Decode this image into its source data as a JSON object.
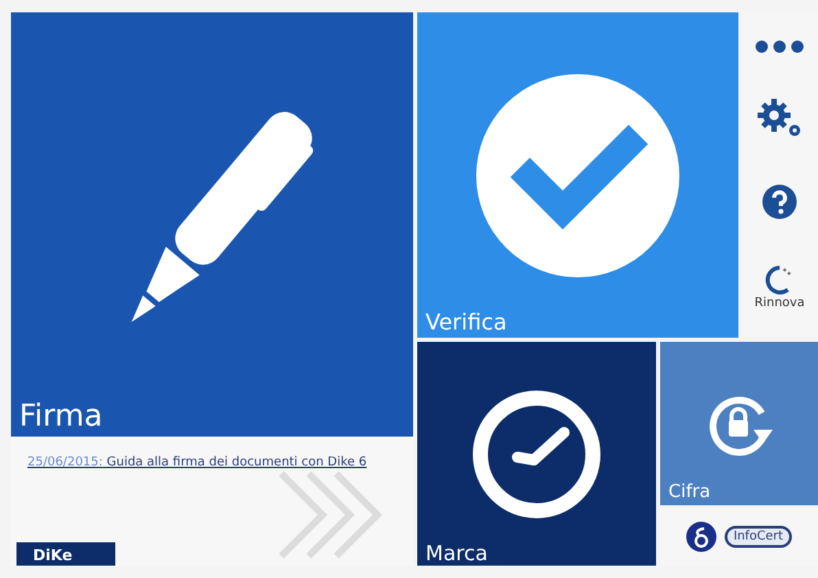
{
  "tiles": [
    {
      "kind": "sign",
      "label": "Firma"
    },
    {
      "kind": "verify",
      "label": "Verifica"
    },
    {
      "kind": "timestamp",
      "label": "Marca"
    },
    {
      "kind": "encrypt",
      "label": "Cifra"
    }
  ],
  "news": {
    "date": "25/06/2015:",
    "title": "Guida alla firma dei documenti con Dike 6"
  },
  "brand": "DiKe",
  "side_items": [
    {
      "kind": "more"
    },
    {
      "kind": "settings"
    },
    {
      "kind": "help"
    },
    {
      "kind": "renew",
      "label": "Rinnova"
    }
  ],
  "logos": [
    {
      "kind": "delta"
    },
    {
      "kind": "badge",
      "text": "InfoCert"
    }
  ]
}
